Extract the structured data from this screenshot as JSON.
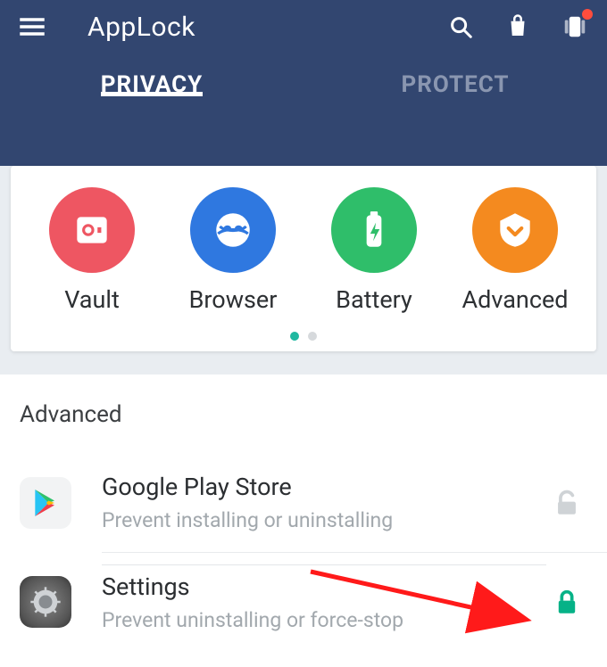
{
  "header": {
    "title": "AppLock",
    "tabs": {
      "privacy": "PRIVACY",
      "protect": "PROTECT"
    }
  },
  "quick": {
    "vault": "Vault",
    "browser": "Browser",
    "battery": "Battery",
    "advanced": "Advanced"
  },
  "section": {
    "title": "Advanced"
  },
  "rows": {
    "play": {
      "title": "Google Play Store",
      "sub": "Prevent installing or uninstalling",
      "locked": false
    },
    "settings": {
      "title": "Settings",
      "sub": "Prevent uninstalling or force-stop",
      "locked": true
    }
  },
  "colors": {
    "header_bg": "#324670",
    "accent_teal": "#1fb8a0",
    "lock_locked": "#06b287",
    "lock_unlocked": "#cfd3d6"
  }
}
